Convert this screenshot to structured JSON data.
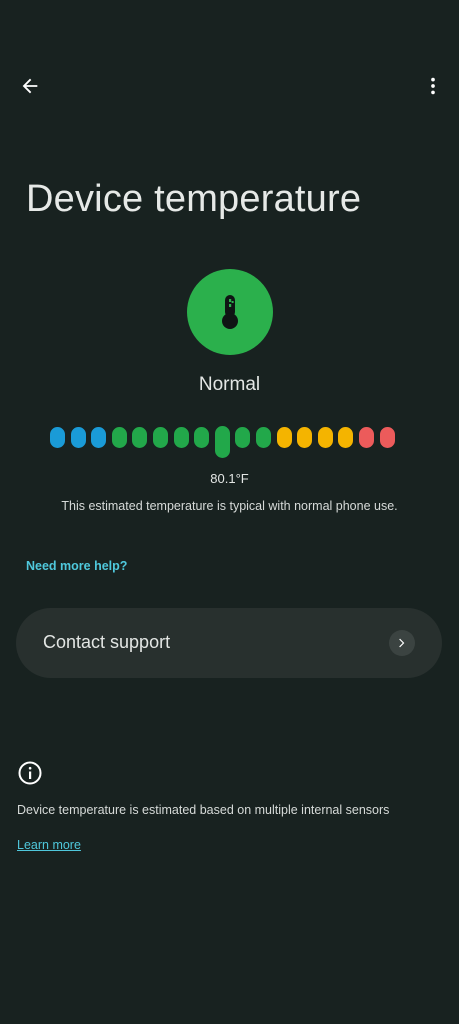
{
  "header": {
    "back_icon": "arrow-back-icon",
    "menu_icon": "more-vert-icon"
  },
  "title": "Device temperature",
  "status": {
    "label": "Normal",
    "icon": "thermometer-icon",
    "color": "#2bb04c"
  },
  "scale": {
    "dot_count": 17,
    "current_index": 8,
    "dot_colors": [
      "#1a9bd7",
      "#1a9bd7",
      "#1a9bd7",
      "#22a84a",
      "#22a84a",
      "#22a84a",
      "#22a84a",
      "#22a84a",
      "#22a84a",
      "#22a84a",
      "#22a84a",
      "#f4b400",
      "#f4b400",
      "#f4b400",
      "#f4b400",
      "#ec5b5b",
      "#ec5b5b"
    ]
  },
  "temperature": {
    "value": "80.1°F",
    "description": "This estimated temperature is typical with normal phone use."
  },
  "help": {
    "link_text": "Need more help?"
  },
  "support": {
    "label": "Contact support",
    "chevron_icon": "chevron-right-icon"
  },
  "info": {
    "icon": "info-icon",
    "text": "Device temperature is estimated based on multiple internal sensors",
    "link_text": "Learn more"
  }
}
